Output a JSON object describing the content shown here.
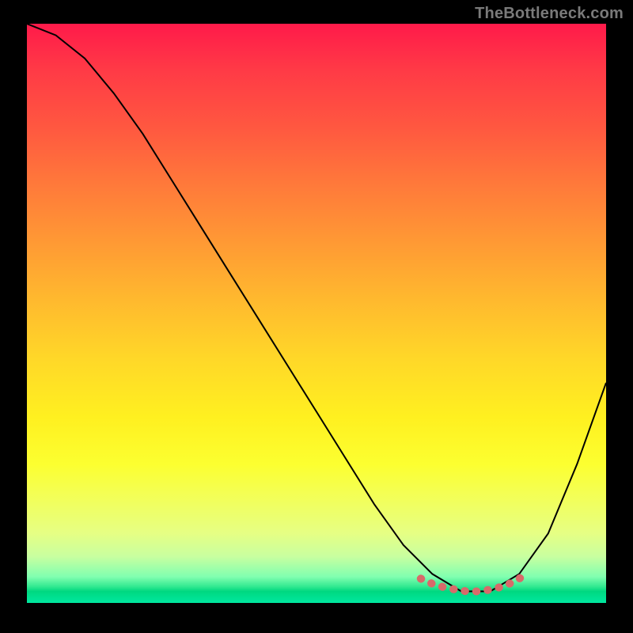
{
  "watermark": "TheBottleneck.com",
  "colors": {
    "page_bg": "#000000",
    "curve_stroke": "#000000",
    "dot_stroke": "#d86a6a",
    "watermark_text": "#7a7a7a"
  },
  "chart_data": {
    "type": "line",
    "title": "",
    "xlabel": "",
    "ylabel": "",
    "xlim": [
      0,
      100
    ],
    "ylim": [
      0,
      100
    ],
    "grid": false,
    "legend": false,
    "x": [
      0,
      5,
      10,
      15,
      20,
      25,
      30,
      35,
      40,
      45,
      50,
      55,
      60,
      65,
      70,
      75,
      80,
      85,
      90,
      95,
      100
    ],
    "series": [
      {
        "name": "bottleneck-curve",
        "color": "#000000",
        "values": [
          100,
          98,
          94,
          88,
          81,
          73,
          65,
          57,
          49,
          41,
          33,
          25,
          17,
          10,
          5,
          2,
          2,
          5,
          12,
          24,
          38
        ]
      }
    ],
    "valley_highlight": {
      "name": "highlight-dots",
      "color": "#d86a6a",
      "x": [
        68,
        70,
        72,
        74,
        76,
        78,
        80,
        82,
        84,
        86
      ],
      "y": [
        4.2,
        3.3,
        2.7,
        2.3,
        2.0,
        2.0,
        2.3,
        2.8,
        3.6,
        4.8
      ]
    }
  }
}
